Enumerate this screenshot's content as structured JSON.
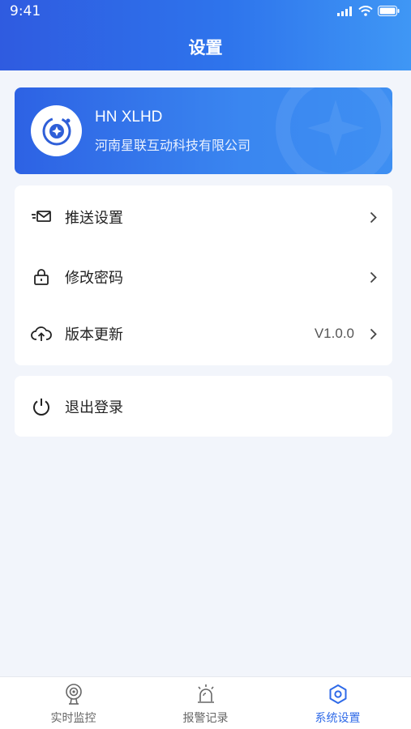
{
  "status_bar": {
    "time": "9:41"
  },
  "header": {
    "title": "设置"
  },
  "profile": {
    "name": "HN XLHD",
    "company": "河南星联互动科技有限公司"
  },
  "menu": {
    "items": [
      {
        "label": "推送设置",
        "icon": "mail-send-icon"
      },
      {
        "label": "修改密码",
        "icon": "lock-icon"
      },
      {
        "label": "版本更新",
        "icon": "cloud-upload-icon",
        "value": "V1.0.0"
      }
    ],
    "logout": {
      "label": "退出登录",
      "icon": "power-icon"
    }
  },
  "tabbar": {
    "tabs": [
      {
        "label": "实时监控",
        "icon": "camera-icon",
        "active": false
      },
      {
        "label": "报警记录",
        "icon": "alarm-icon",
        "active": false
      },
      {
        "label": "系统设置",
        "icon": "settings-hex-icon",
        "active": true
      }
    ]
  },
  "colors": {
    "primary": "#2f6ae8",
    "header_start": "#2f5be0",
    "header_end": "#3f97f5",
    "background": "#f2f5fb"
  }
}
